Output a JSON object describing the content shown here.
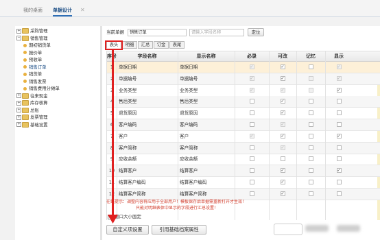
{
  "tabs": {
    "home": "我的桌面",
    "active": "单据设计",
    "close": "✕"
  },
  "tree": {
    "items": [
      {
        "label": "采购管理",
        "level": 0,
        "type": "folder",
        "toggle": "+"
      },
      {
        "label": "销售管理",
        "level": 0,
        "type": "folder",
        "toggle": "−"
      },
      {
        "label": "期初销货单",
        "level": 1,
        "type": "doc"
      },
      {
        "label": "报价单",
        "level": 1,
        "type": "doc"
      },
      {
        "label": "预收单",
        "level": 1,
        "type": "doc"
      },
      {
        "label": "销售订单",
        "level": 1,
        "type": "doc",
        "selected": true
      },
      {
        "label": "销货单",
        "level": 1,
        "type": "doc"
      },
      {
        "label": "销售发票",
        "level": 1,
        "type": "doc"
      },
      {
        "label": "销售费用分摊单",
        "level": 1,
        "type": "doc"
      },
      {
        "label": "往来现金",
        "level": 0,
        "type": "folder",
        "toggle": "+"
      },
      {
        "label": "库存核算",
        "level": 0,
        "type": "folder",
        "toggle": "+"
      },
      {
        "label": "总账",
        "level": 0,
        "type": "folder",
        "toggle": "+"
      },
      {
        "label": "发票管理",
        "level": 0,
        "type": "folder",
        "toggle": "+"
      },
      {
        "label": "基础设置",
        "level": 0,
        "type": "folder",
        "toggle": "+"
      }
    ]
  },
  "form": {
    "current_label": "当前单据",
    "current_value": "销售订单",
    "search_placeholder": "请输入字段名称",
    "locate_button": "定位"
  },
  "subtabs": [
    "表头",
    "明细",
    "汇总",
    "订金",
    "表尾"
  ],
  "grid": {
    "headers": [
      "序号",
      "字段名称",
      "显示名称",
      "必录",
      "可改",
      "记忆",
      "显示"
    ],
    "rows": [
      {
        "no": "1",
        "field": "单据日期",
        "display": "单据日期",
        "req": "on-dis",
        "edit": "on",
        "mem": "off",
        "show": "on-dis"
      },
      {
        "no": "2",
        "field": "单据编号",
        "display": "单据编号",
        "req": "on-dis",
        "edit": "on",
        "mem": "off-dis",
        "show": "on-dis"
      },
      {
        "no": "3",
        "field": "业务类型",
        "display": "业务类型",
        "req": "on-dis",
        "edit": "on-dis",
        "mem": "off-dis",
        "show": "on"
      },
      {
        "no": "4",
        "field": "售后类型",
        "display": "售后类型",
        "req": "off",
        "edit": "on",
        "mem": "off",
        "show": "off"
      },
      {
        "no": "5",
        "field": "退货原因",
        "display": "退货原因",
        "req": "off",
        "edit": "on",
        "mem": "off",
        "show": "off"
      },
      {
        "no": "6",
        "field": "客户编码",
        "display": "客户编码",
        "req": "off",
        "edit": "on-dis",
        "mem": "off",
        "show": "off"
      },
      {
        "no": "7",
        "field": "客户",
        "display": "客户",
        "req": "on-dis",
        "edit": "on",
        "mem": "off",
        "show": "on"
      },
      {
        "no": "8",
        "field": "客户简称",
        "display": "客户简称",
        "req": "off",
        "edit": "on-dis",
        "mem": "off",
        "show": "off"
      },
      {
        "no": "9",
        "field": "应收余额",
        "display": "应收余额",
        "req": "off",
        "edit": "off",
        "mem": "off",
        "show": "off"
      },
      {
        "no": "10",
        "field": "结算客户",
        "display": "结算客户",
        "req": "off",
        "edit": "on",
        "mem": "off",
        "show": "on"
      },
      {
        "no": "11",
        "field": "结算客户编码",
        "display": "结算客户编码",
        "req": "off",
        "edit": "on",
        "mem": "off",
        "show": "off"
      },
      {
        "no": "12",
        "field": "结算客户简称",
        "display": "结算客户简称",
        "req": "off",
        "edit": "on",
        "mem": "off",
        "show": "off"
      }
    ]
  },
  "notice": {
    "line1": "在线提示：调整内容将应用于全部用户！模板保存后单据需重新打开才生效！",
    "line2": "只能对明细表体中显示的字段进行汇总设置！"
  },
  "window_size_label": "窗口大小固定",
  "buttons": {
    "custom_settings": "自定义项设置",
    "reference_archive": "引用基础档案属性"
  },
  "colors": {
    "accent": "#2f6fb6",
    "highlight": "#e02020",
    "hint": "#d13b2a"
  }
}
